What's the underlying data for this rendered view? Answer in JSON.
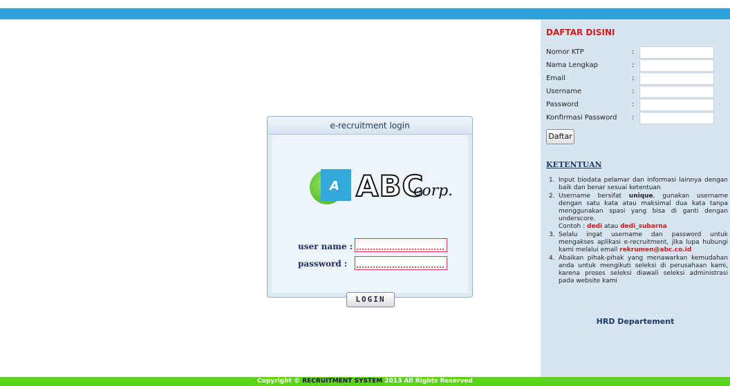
{
  "login": {
    "title": "e-recruitment login",
    "logo_text": "ABC",
    "logo_corp": "corp.",
    "logo_letter": "A",
    "user_label": "user name :",
    "pass_label": "password  :",
    "user_value": "",
    "pass_value": "",
    "button_label": "LOGIN"
  },
  "register": {
    "title": "DAFTAR DISINI",
    "fields": [
      {
        "label": "Nomor KTP",
        "value": ""
      },
      {
        "label": "Nama Lengkap",
        "value": ""
      },
      {
        "label": "Email",
        "value": ""
      },
      {
        "label": "Username",
        "value": ""
      },
      {
        "label": "Password",
        "value": ""
      },
      {
        "label": "Konfirmasi Password",
        "value": ""
      }
    ],
    "colon": ":",
    "button_label": "Daftar"
  },
  "rules": {
    "title": "KETENTUAN",
    "items": [
      {
        "num": "1.",
        "text": "Input biodata pelamar dan informasi lainnya dengan baik dan benar sesuai ketentuan"
      },
      {
        "num": "2.",
        "pre": "Username bersifat ",
        "bold": "unique",
        "post": ", gunakan username dengan satu kata atau maksimal dua kata tanpa menggunakan spasi yang bisa di ganti dengan underscore.",
        "example_label": "Contoh : ",
        "ex1": "dedi",
        "ex_mid": " atau ",
        "ex2": "dedi_subarna"
      },
      {
        "num": "3.",
        "text": "Selalu ingat username dan password untuk mengakses aplikasi e-recruitment, jika lupa hubungi kami melalui email ",
        "email": "rekrumen@abc.co.id"
      },
      {
        "num": "4.",
        "text": "Abaikan pihak-pihak yang menawarkan kemudahan anda untuk mengikuti seleksi di perusahaan kami, karena proses seleksi diawali seleksi administrasi pada website kami"
      }
    ],
    "signature": "HRD Departement"
  },
  "footer": {
    "prefix": "Copyright © ",
    "system": "RECRUITMENT SYSTEM",
    "suffix": " 2013 All Rights Reserved"
  },
  "colors": {
    "topbar": "#2d9fd9",
    "footer": "#59d418",
    "panel": "#d7e4f1",
    "accent_red": "#d11a1a"
  }
}
